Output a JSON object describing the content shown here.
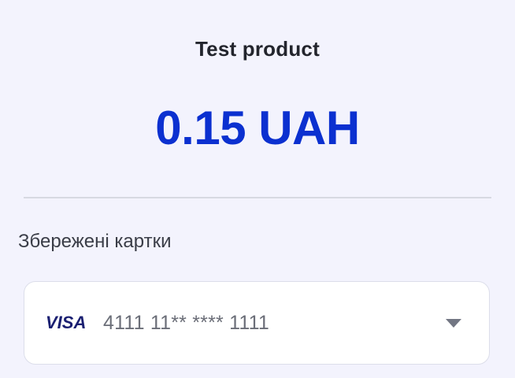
{
  "product": {
    "title": "Test product",
    "price": "0.15 UAH"
  },
  "saved_cards": {
    "label": "Збережені картки",
    "selected": {
      "brand": "VISA",
      "brand_icon": "visa-logo",
      "masked_number": "4111 11** **** 1111"
    }
  },
  "colors": {
    "background": "#f3f3fd",
    "price_accent": "#0b30d0",
    "visa_brand": "#1a1f71"
  }
}
